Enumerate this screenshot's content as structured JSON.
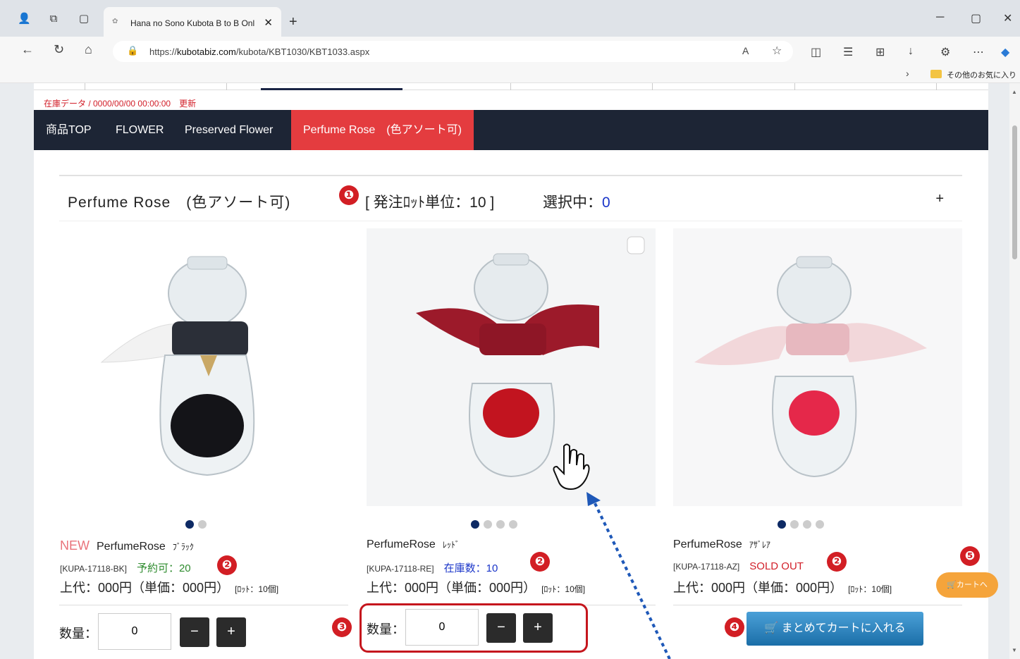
{
  "browser": {
    "tab_title": "Hana no Sono Kubota B to B Onl",
    "url_prefix": "https://",
    "url_host": "kubotabiz.com",
    "url_path": "/kubota/KBT1030/KBT1033.aspx",
    "favorites_label": "その他のお気に入り"
  },
  "page": {
    "stock_update": "在庫データ / 0000/00/00 00:00:00　更新",
    "menu": [
      "商品TOP",
      "FLOWER",
      "Preserved Flower",
      "Perfume Rose　(色アソート可)"
    ],
    "section": {
      "name": "Perfume Rose　(色アソート可)",
      "lot_label": "[ 発注ﾛｯﾄ単位：10 ]",
      "selected_label": "選択中：",
      "selected_count": "0",
      "expand": "+"
    },
    "products": [
      {
        "new": "NEW",
        "name": "PerfumeRose",
        "variant": "ﾌﾞﾗｯｸ",
        "code": "[KUPA-17118-BK]",
        "status": "予約可：20",
        "status_color": "#2e8b2e",
        "price": "上代：000円（単価：000円）",
        "lot": "[ﾛｯﾄ：10個]",
        "qty_label": "数量：",
        "qty": "0",
        "dots_total": 2
      },
      {
        "new": "",
        "name": "PerfumeRose",
        "variant": "ﾚｯﾄﾞ",
        "code": "[KUPA-17118-RE]",
        "status": "在庫数：10",
        "status_color": "#1a35c9",
        "price": "上代：000円（単価：000円）",
        "lot": "[ﾛｯﾄ：10個]",
        "qty_label": "数量：",
        "qty": "0",
        "dots_total": 4
      },
      {
        "new": "",
        "name": "PerfumeRose",
        "variant": "ｱｻﾞﾚｱ",
        "code": "[KUPA-17118-AZ]",
        "status": "SOLD OUT",
        "status_color": "#d2202a",
        "price": "上代：000円（単価：000円）",
        "lot": "[ﾛｯﾄ：10個]",
        "dots_total": 4
      }
    ],
    "cart_all_button": "まとめてカートに入れる",
    "to_cart_button": "カートへ",
    "minus": "−",
    "plus": "+"
  },
  "annotations": [
    "❶",
    "❷",
    "❷",
    "❷",
    "❸",
    "❹",
    "❺"
  ],
  "colors": {
    "nav_bg": "#1d2535",
    "nav_active": "#e43c3f",
    "badge": "#d21e24"
  }
}
